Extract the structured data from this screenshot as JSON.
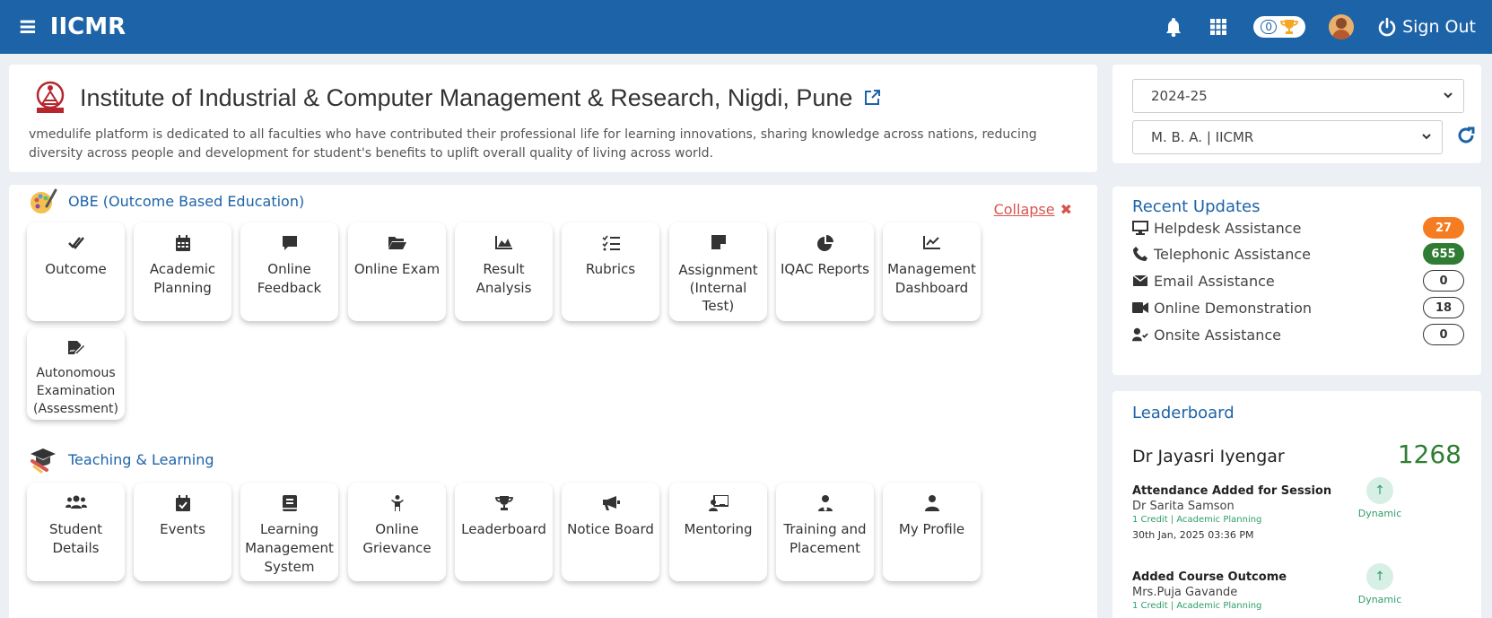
{
  "topbar": {
    "brand": "IICMR",
    "trophy_count": "0",
    "sign_out": "Sign Out"
  },
  "institute": {
    "name": "Institute of Industrial & Computer Management & Research, Nigdi, Pune",
    "description": "vmedulife platform is dedicated to all faculties who have contributed their professional life for learning innovations, sharing knowledge across nations, reducing diversity across people and development for student's benefits to uplift overall quality of living across world."
  },
  "obe": {
    "title": "OBE (Outcome Based Education)",
    "collapse": "Collapse",
    "tiles": [
      {
        "label": "Outcome",
        "icon": "check-double-icon"
      },
      {
        "label": "Academic Planning",
        "icon": "calendar-icon"
      },
      {
        "label": "Online Feedback",
        "icon": "comment-icon"
      },
      {
        "label": "Online Exam",
        "icon": "folder-open-icon"
      },
      {
        "label": "Result Analysis",
        "icon": "area-chart-icon"
      },
      {
        "label": "Rubrics",
        "icon": "list-check-icon"
      },
      {
        "label": "Assignment (Internal Test)",
        "icon": "note-icon"
      },
      {
        "label": "IQAC Reports",
        "icon": "pie-chart-icon"
      },
      {
        "label": "Management Dashboard",
        "icon": "line-chart-icon"
      },
      {
        "label": "Autonomous Examination (Assessment)",
        "icon": "signature-icon"
      }
    ]
  },
  "teaching": {
    "title": "Teaching & Learning",
    "tiles": [
      {
        "label": "Student Details",
        "icon": "users-icon"
      },
      {
        "label": "Events",
        "icon": "calendar-check-icon"
      },
      {
        "label": "Learning Management System",
        "icon": "book-icon"
      },
      {
        "label": "Online Grievance",
        "icon": "child-icon"
      },
      {
        "label": "Leaderboard",
        "icon": "trophy-icon"
      },
      {
        "label": "Notice Board",
        "icon": "bullhorn-icon"
      },
      {
        "label": "Mentoring",
        "icon": "chalkboard-teacher-icon"
      },
      {
        "label": "Training and Placement",
        "icon": "user-tie-icon"
      },
      {
        "label": "My Profile",
        "icon": "user-icon"
      }
    ]
  },
  "filters": {
    "year": "2024-25",
    "program": "M. B. A. | IICMR"
  },
  "updates": {
    "title": "Recent Updates",
    "items": [
      {
        "label": "Helpdesk Assistance",
        "count": "27",
        "icon": "desktop-icon",
        "style": "orange"
      },
      {
        "label": "Telephonic Assistance",
        "count": "655",
        "icon": "phone-icon",
        "style": "green"
      },
      {
        "label": "Email Assistance",
        "count": "0",
        "icon": "envelope-icon",
        "style": "outline"
      },
      {
        "label": "Online Demonstration",
        "count": "18",
        "icon": "video-icon",
        "style": "outline"
      },
      {
        "label": "Onsite Assistance",
        "count": "0",
        "icon": "user-check-icon",
        "style": "outline"
      }
    ]
  },
  "leaderboard": {
    "title": "Leaderboard",
    "leader_name": "Dr Jayasri Iyengar",
    "leader_score": "1268",
    "activities": [
      {
        "title": "Attendance Added for Session",
        "who": "Dr Sarita Samson",
        "meta": "1 Credit | Academic Planning",
        "time": "30th Jan, 2025 03:36 PM",
        "tag": "Dynamic"
      },
      {
        "title": "Added Course Outcome",
        "who": "Mrs.Puja Gavande",
        "meta": "1 Credit | Academic Planning",
        "time": "",
        "tag": "Dynamic"
      }
    ]
  },
  "colors": {
    "topbar": "#1d63a8",
    "accent": "#1d63a8",
    "orange_badge": "#f57c20",
    "green_badge": "#2e7d32",
    "collapse": "#d9534f"
  }
}
